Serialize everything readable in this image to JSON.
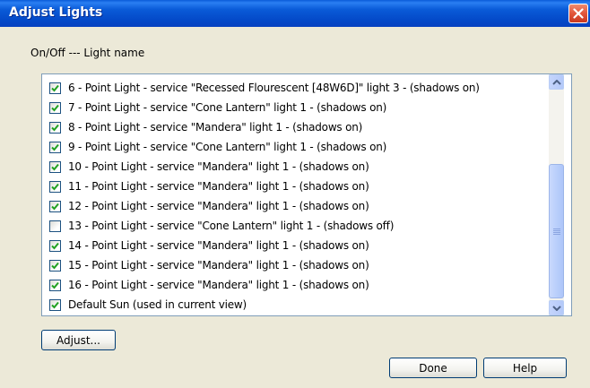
{
  "window": {
    "title": "Adjust Lights"
  },
  "list": {
    "header": "On/Off --- Light name",
    "items": [
      {
        "label": "6 - Point Light  - service \"Recessed Flourescent [48W6D]\" light 3 - (shadows on)",
        "checked": true
      },
      {
        "label": "7 - Point Light  - service \"Cone Lantern\" light 1 - (shadows on)",
        "checked": true
      },
      {
        "label": "8 - Point Light  - service \"Mandera\" light 1 - (shadows on)",
        "checked": true
      },
      {
        "label": "9 - Point Light  - service \"Cone Lantern\" light 1 - (shadows on)",
        "checked": true
      },
      {
        "label": "10 - Point Light  - service \"Mandera\" light 1 - (shadows on)",
        "checked": true
      },
      {
        "label": "11 - Point Light  - service \"Mandera\" light 1 - (shadows on)",
        "checked": true
      },
      {
        "label": "12 - Point Light  - service \"Mandera\" light 1 - (shadows on)",
        "checked": true
      },
      {
        "label": "13 - Point Light  - service \"Cone Lantern\" light 1 - (shadows off)",
        "checked": false
      },
      {
        "label": "14 - Point Light  - service \"Mandera\" light 1 - (shadows on)",
        "checked": true
      },
      {
        "label": "15 - Point Light  - service \"Mandera\" light 1 - (shadows on)",
        "checked": true
      },
      {
        "label": "16 - Point Light  - service \"Mandera\" light 1 - (shadows on)",
        "checked": true
      },
      {
        "label": "Default Sun (used in current view)",
        "checked": true
      }
    ]
  },
  "buttons": {
    "adjust": "Adjust...",
    "done": "Done",
    "help": "Help"
  },
  "colors": {
    "titlebar": "#0a5bd8",
    "dialog_bg": "#ece9d8",
    "checkmark": "#21a121",
    "close": "#e2553a"
  },
  "icons": {
    "close": "close-icon",
    "scroll_up": "chevron-up-icon",
    "scroll_down": "chevron-down-icon"
  }
}
